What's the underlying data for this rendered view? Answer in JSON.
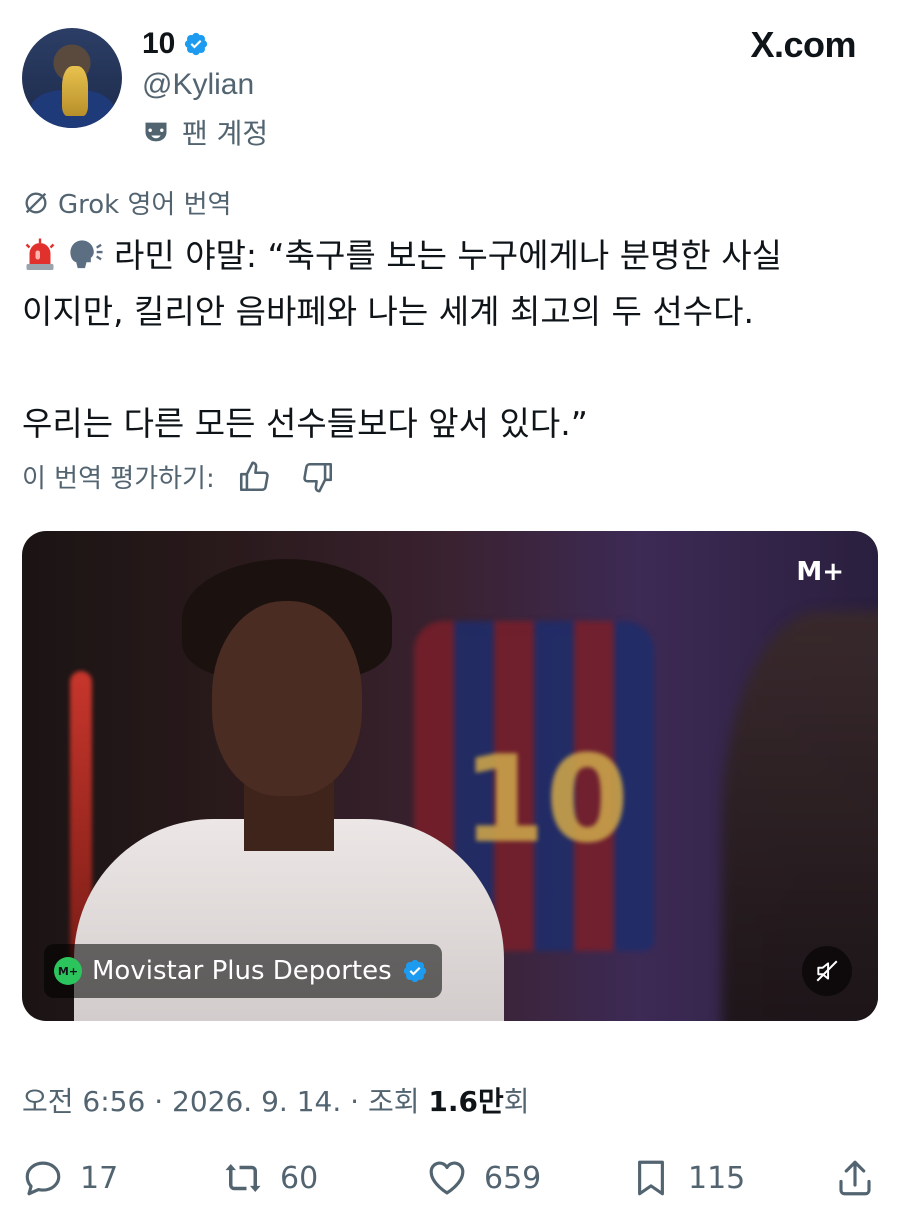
{
  "author": {
    "display_name": "10",
    "handle": "@Kylian",
    "account_label": "팬 계정",
    "verified": true
  },
  "brand": "X.com",
  "translation": {
    "label": "Grok 영어 번역",
    "rate_label": "이 번역 평가하기:"
  },
  "tweet": {
    "line1": "라민 야말: “축구를 보는 누구에게나 분명한 사실",
    "line2": "이지만, 킬리안 음바페와 나는 세계 최고의 두 선수다.",
    "line3": "우리는 다른 모든 선수들보다 앞서 있다.”",
    "emojis": [
      "siren-emoji",
      "speaking-head-emoji"
    ]
  },
  "media": {
    "watermark": "M+",
    "source_name": "Movistar Plus Deportes",
    "source_logo_text": "M+",
    "jersey_number": "10"
  },
  "meta": {
    "time": "오전 6:56",
    "date": "2026. 9. 14.",
    "views_label": "조회",
    "views_value": "1.6만",
    "views_suffix": "회"
  },
  "actions": {
    "replies": "17",
    "retweets": "60",
    "likes": "659",
    "bookmarks": "115"
  },
  "colors": {
    "verified_blue": "#1d9bf0",
    "secondary_text": "#536471",
    "primary_text": "#0f1419",
    "movistar_green": "#2cc45c"
  }
}
